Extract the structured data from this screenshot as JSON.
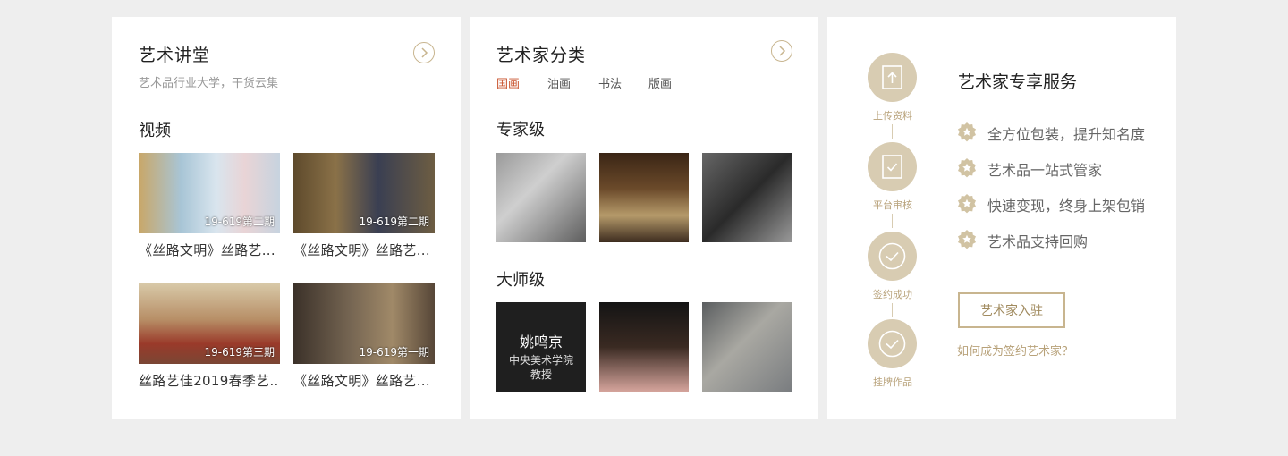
{
  "lecture": {
    "title": "艺术讲堂",
    "subtitle": "艺术品行业大学，干货云集",
    "section": "视频",
    "videos": [
      {
        "tag": "19-619第二期",
        "title": "《丝路文明》丝路艺..."
      },
      {
        "tag": "19-619第二期",
        "title": "《丝路文明》丝路艺..."
      },
      {
        "tag": "19-619第三期",
        "title": "丝路艺佳2019春季艺..."
      },
      {
        "tag": "19-619第一期",
        "title": "《丝路文明》丝路艺..."
      }
    ]
  },
  "category": {
    "title": "艺术家分类",
    "tabs": [
      "国画",
      "油画",
      "书法",
      "版画"
    ],
    "active_tab": "国画",
    "expert_title": "专家级",
    "master_title": "大师级",
    "featured_artist": {
      "name": "姚鸣京",
      "org": "中央美术学院",
      "position": "教授"
    }
  },
  "service": {
    "title": "艺术家专享服务",
    "steps": [
      "上传资料",
      "平台审核",
      "签约成功",
      "挂牌作品"
    ],
    "features": [
      "全方位包装，提升知名度",
      "艺术品一站式管家",
      "快速变现，终身上架包销",
      "艺术品支持回购"
    ],
    "join_button": "艺术家入驻",
    "how_link": "如何成为签约艺术家？"
  },
  "colors": {
    "gold": "#c8b58f",
    "step_circle": "#d8ccb2",
    "active_tab": "#c9532e",
    "background": "#eeeeee"
  }
}
